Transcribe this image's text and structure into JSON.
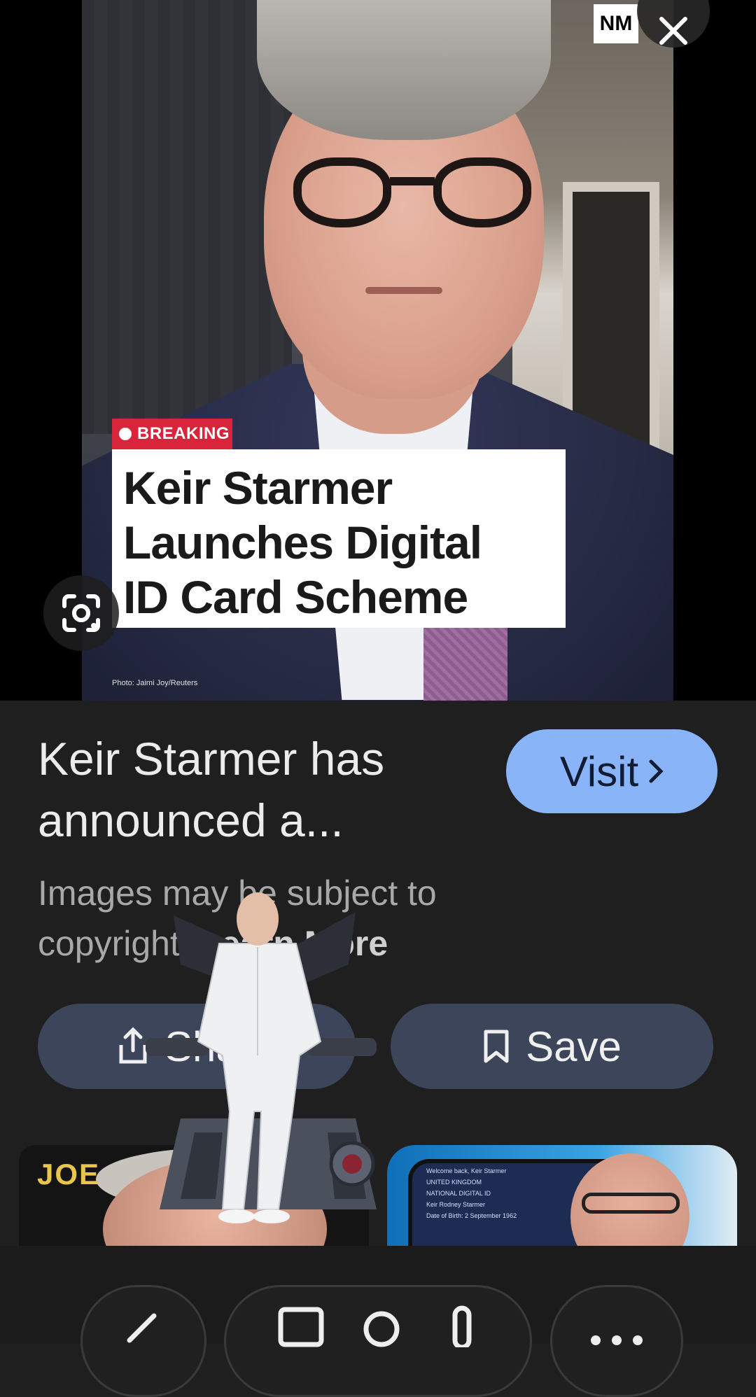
{
  "image_view": {
    "badge_text": "BREAKING",
    "headline_lines": [
      "Keir Starmer",
      "Launches Digital",
      "ID Card Scheme"
    ],
    "photo_credit": "Photo: Jaimi Joy/Reuters",
    "source_logo": "NM",
    "close_icon": "close-icon",
    "lens_icon": "google-lens-icon"
  },
  "result": {
    "title_line1": "Keir Starmer has",
    "title_line2": "announced a...",
    "visit_label": "Visit",
    "copyright_line1": "Images may be subject to",
    "copyright_line2": "copyright.",
    "learn_more": "Learn More"
  },
  "actions": {
    "share_label": "Share",
    "save_label": "Save"
  },
  "related": [
    {
      "label": "JOE"
    },
    {
      "phone_lines": [
        "Welcome back, Keir Starmer",
        "UNITED KINGDOM",
        "NATIONAL DIGITAL ID",
        "Keir Rodney Starmer",
        "Date of Birth: 2 September 1962"
      ]
    }
  ],
  "bottom_bar": {
    "icons": [
      "edit-icon",
      "copy-icon",
      "search-icon",
      "mic-icon",
      "more-icon"
    ]
  },
  "colors": {
    "background": "#1f1f1f",
    "visit_button": "#8ab4f8",
    "pill_button": "#3c4559",
    "breaking_red": "#d8253b"
  }
}
